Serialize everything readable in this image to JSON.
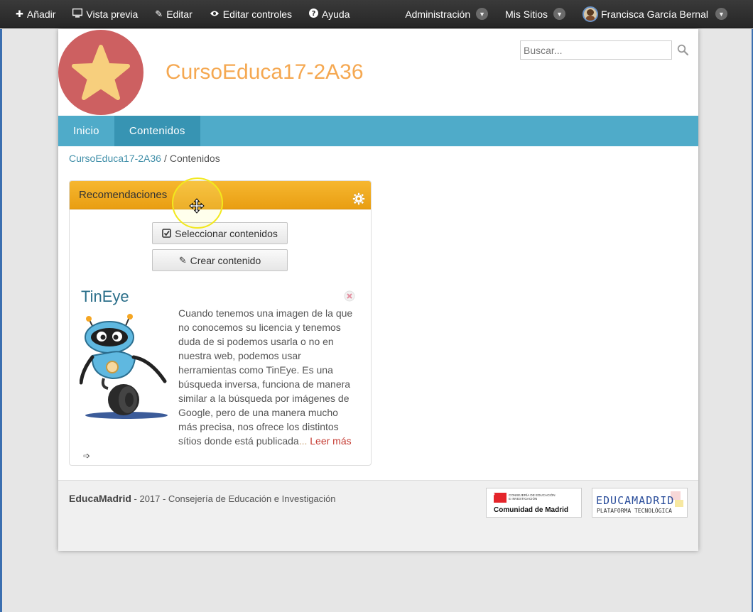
{
  "dockbar": {
    "add_label": "Añadir",
    "preview_label": "Vista previa",
    "edit_label": "Editar",
    "edit_controls_label": "Editar controles",
    "help_label": "Ayuda",
    "admin_label": "Administración",
    "my_sites_label": "Mis Sitios",
    "user_name": "Francisca García Bernal"
  },
  "header": {
    "site_title": "CursoEduca17-2A36",
    "search_placeholder": "Buscar..."
  },
  "nav": {
    "items": [
      {
        "label": "Inicio",
        "active": false
      },
      {
        "label": "Contenidos",
        "active": true
      }
    ]
  },
  "breadcrumb": {
    "site": "CursoEduca17-2A36",
    "separator": "/",
    "current": "Contenidos"
  },
  "portlet": {
    "title": "Recomendaciones",
    "select_button": "Seleccionar contenidos",
    "create_button": "Crear contenido",
    "asset": {
      "title": "TinEye",
      "summary": "Cuando tenemos una imagen de la que no conocemos su licencia y tenemos duda de si podemos usarla o no en nuestra web, podemos usar herramientas como TinEye. Es una búsqueda inversa, funciona de manera similar a la búsqueda por imágenes de Google, pero de una manera mucho más precisa, nos ofrece los distintos sítios donde está publicada",
      "ellipsis": "...",
      "read_more": "Leer más"
    }
  },
  "footer": {
    "brand": "EducaMadrid",
    "text": " - 2017 - Consejería de Educación e Investigación",
    "cm_line1": "CONSEJERÍA DE EDUCACIÓN",
    "cm_line2": "E INVESTIGACIÓN",
    "cm_name": "Comunidad de Madrid",
    "em_name": "EDUCAMADRID",
    "em_sub": "PLATAFORMA TECNOLÓGICA"
  },
  "colors": {
    "nav_bg": "#4fabc9",
    "nav_active": "#3794b3",
    "title_orange": "#f5a851",
    "logo_red": "#cd6061",
    "portlet_head": "#f0a820",
    "read_more": "#c53b32"
  },
  "icons": [
    "plus-icon",
    "monitor-icon",
    "edit-icon",
    "eye-icon",
    "question-icon",
    "star-icon",
    "search-icon",
    "gear-icon",
    "checkbox-icon",
    "pencil-icon",
    "close-icon",
    "arrow-right-icon",
    "move-cursor-icon"
  ]
}
